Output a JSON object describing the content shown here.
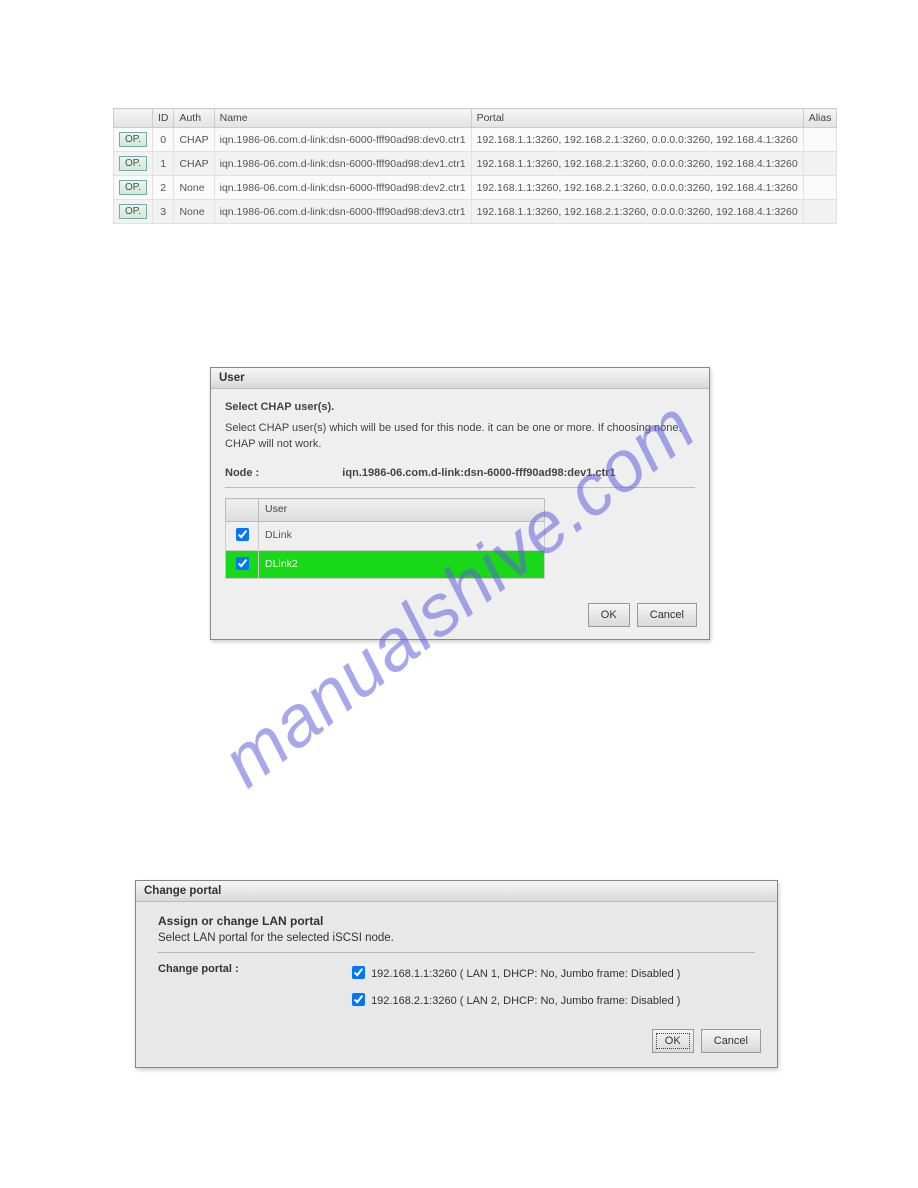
{
  "top_table": {
    "headers": {
      "op": "",
      "id": "ID",
      "auth": "Auth",
      "name": "Name",
      "portal": "Portal",
      "alias": "Alias"
    },
    "op_label": "OP.",
    "rows": [
      {
        "id": "0",
        "auth": "CHAP",
        "name": "iqn.1986-06.com.d-link:dsn-6000-fff90ad98:dev0.ctr1",
        "portal": "192.168.1.1:3260, 192.168.2.1:3260, 0.0.0.0:3260, 192.168.4.1:3260",
        "alias": ""
      },
      {
        "id": "1",
        "auth": "CHAP",
        "name": "iqn.1986-06.com.d-link:dsn-6000-fff90ad98:dev1.ctr1",
        "portal": "192.168.1.1:3260, 192.168.2.1:3260, 0.0.0.0:3260, 192.168.4.1:3260",
        "alias": ""
      },
      {
        "id": "2",
        "auth": "None",
        "name": "iqn.1986-06.com.d-link:dsn-6000-fff90ad98:dev2.ctr1",
        "portal": "192.168.1.1:3260, 192.168.2.1:3260, 0.0.0.0:3260, 192.168.4.1:3260",
        "alias": ""
      },
      {
        "id": "3",
        "auth": "None",
        "name": "iqn.1986-06.com.d-link:dsn-6000-fff90ad98:dev3.ctr1",
        "portal": "192.168.1.1:3260, 192.168.2.1:3260, 0.0.0.0:3260, 192.168.4.1:3260",
        "alias": ""
      }
    ]
  },
  "user_dialog": {
    "title": "User",
    "subtitle": "Select CHAP user(s).",
    "description": "Select CHAP user(s) which will be used for this node. it can be one or more. If choosing none, CHAP will not work.",
    "node_label": "Node :",
    "node_value": "iqn.1986-06.com.d-link:dsn-6000-fff90ad98:dev1.ctr1",
    "user_header": "User",
    "users": [
      {
        "name": "DLink",
        "checked": true,
        "selected": false
      },
      {
        "name": "DLink2",
        "checked": true,
        "selected": true
      }
    ],
    "ok": "OK",
    "cancel": "Cancel"
  },
  "portal_dialog": {
    "title": "Change portal",
    "heading": "Assign or change LAN portal",
    "hint": "Select LAN portal for the selected iSCSI node.",
    "label": "Change portal :",
    "options": [
      {
        "text": "192.168.1.1:3260 ( LAN 1, DHCP: No, Jumbo frame: Disabled )",
        "checked": true
      },
      {
        "text": "192.168.2.1:3260 ( LAN 2, DHCP: No, Jumbo frame: Disabled )",
        "checked": true
      }
    ],
    "ok": "OK",
    "cancel": "Cancel"
  },
  "watermark": "manualshive.com"
}
